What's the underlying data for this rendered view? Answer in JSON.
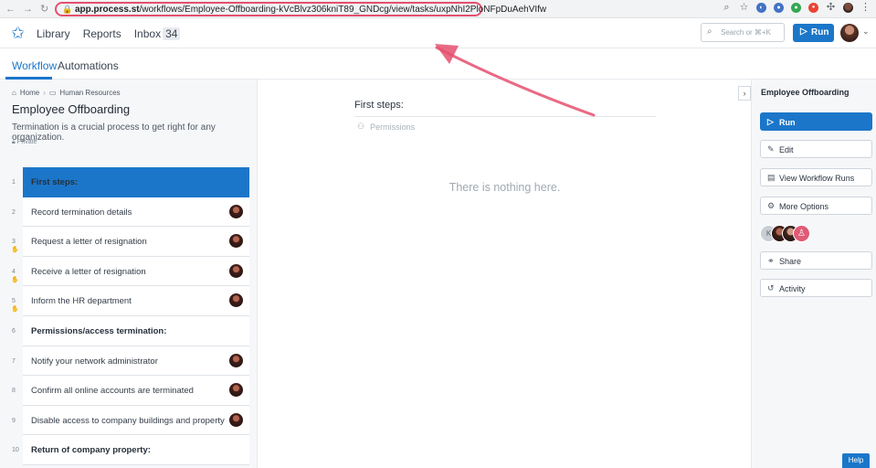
{
  "browser": {
    "url_host": "app.process.st",
    "url_path": "/workflows/Employee-Offboarding-kVcBlvz306kniT89_GNDcg/view/tasks/uxpNhI2PloNFpDuAehVIfw"
  },
  "header": {
    "nav": {
      "library": "Library",
      "reports": "Reports",
      "inbox": "Inbox",
      "inbox_count": "34"
    },
    "search_placeholder": "Search or ⌘+K",
    "run_label": "Run"
  },
  "tabs": {
    "workflow": "Workflow",
    "automations": "Automations"
  },
  "left": {
    "breadcrumb": {
      "home": "Home",
      "folder": "Human Resources"
    },
    "title": "Employee Offboarding",
    "description": "Termination is a crucial process to get right for any organization.",
    "private_label": "Private",
    "tasks": [
      {
        "num": "1",
        "label": "First steps:",
        "heading": true,
        "selected": true,
        "avatar": false,
        "hand": false
      },
      {
        "num": "2",
        "label": "Record termination details",
        "heading": false,
        "selected": false,
        "avatar": true,
        "hand": false
      },
      {
        "num": "3",
        "label": "Request a letter of resignation",
        "heading": false,
        "selected": false,
        "avatar": true,
        "hand": true
      },
      {
        "num": "4",
        "label": "Receive a letter of resignation",
        "heading": false,
        "selected": false,
        "avatar": true,
        "hand": true
      },
      {
        "num": "5",
        "label": "Inform the HR department",
        "heading": false,
        "selected": false,
        "avatar": true,
        "hand": true
      },
      {
        "num": "6",
        "label": "Permissions/access termination:",
        "heading": true,
        "selected": false,
        "avatar": false,
        "hand": false
      },
      {
        "num": "7",
        "label": "Notify your network administrator",
        "heading": false,
        "selected": false,
        "avatar": true,
        "hand": false
      },
      {
        "num": "8",
        "label": "Confirm all online accounts are terminated",
        "heading": false,
        "selected": false,
        "avatar": true,
        "hand": false
      },
      {
        "num": "9",
        "label": "Disable access to company buildings and property",
        "heading": false,
        "selected": false,
        "avatar": true,
        "hand": false
      },
      {
        "num": "10",
        "label": "Return of company property:",
        "heading": true,
        "selected": false,
        "avatar": false,
        "hand": false
      }
    ]
  },
  "main": {
    "section_title": "First steps:",
    "permissions_label": "Permissions",
    "empty_text": "There is nothing here."
  },
  "right": {
    "title": "Employee Offboarding",
    "buttons": {
      "run": "Run",
      "edit": "Edit",
      "view_runs": "View Workflow Runs",
      "more_options": "More Options",
      "share": "Share",
      "activity": "Activity"
    },
    "avatar_initial": "K"
  },
  "help_label": "Help",
  "colors": {
    "accent": "#1b76c9",
    "annotation": "#e5506e"
  }
}
